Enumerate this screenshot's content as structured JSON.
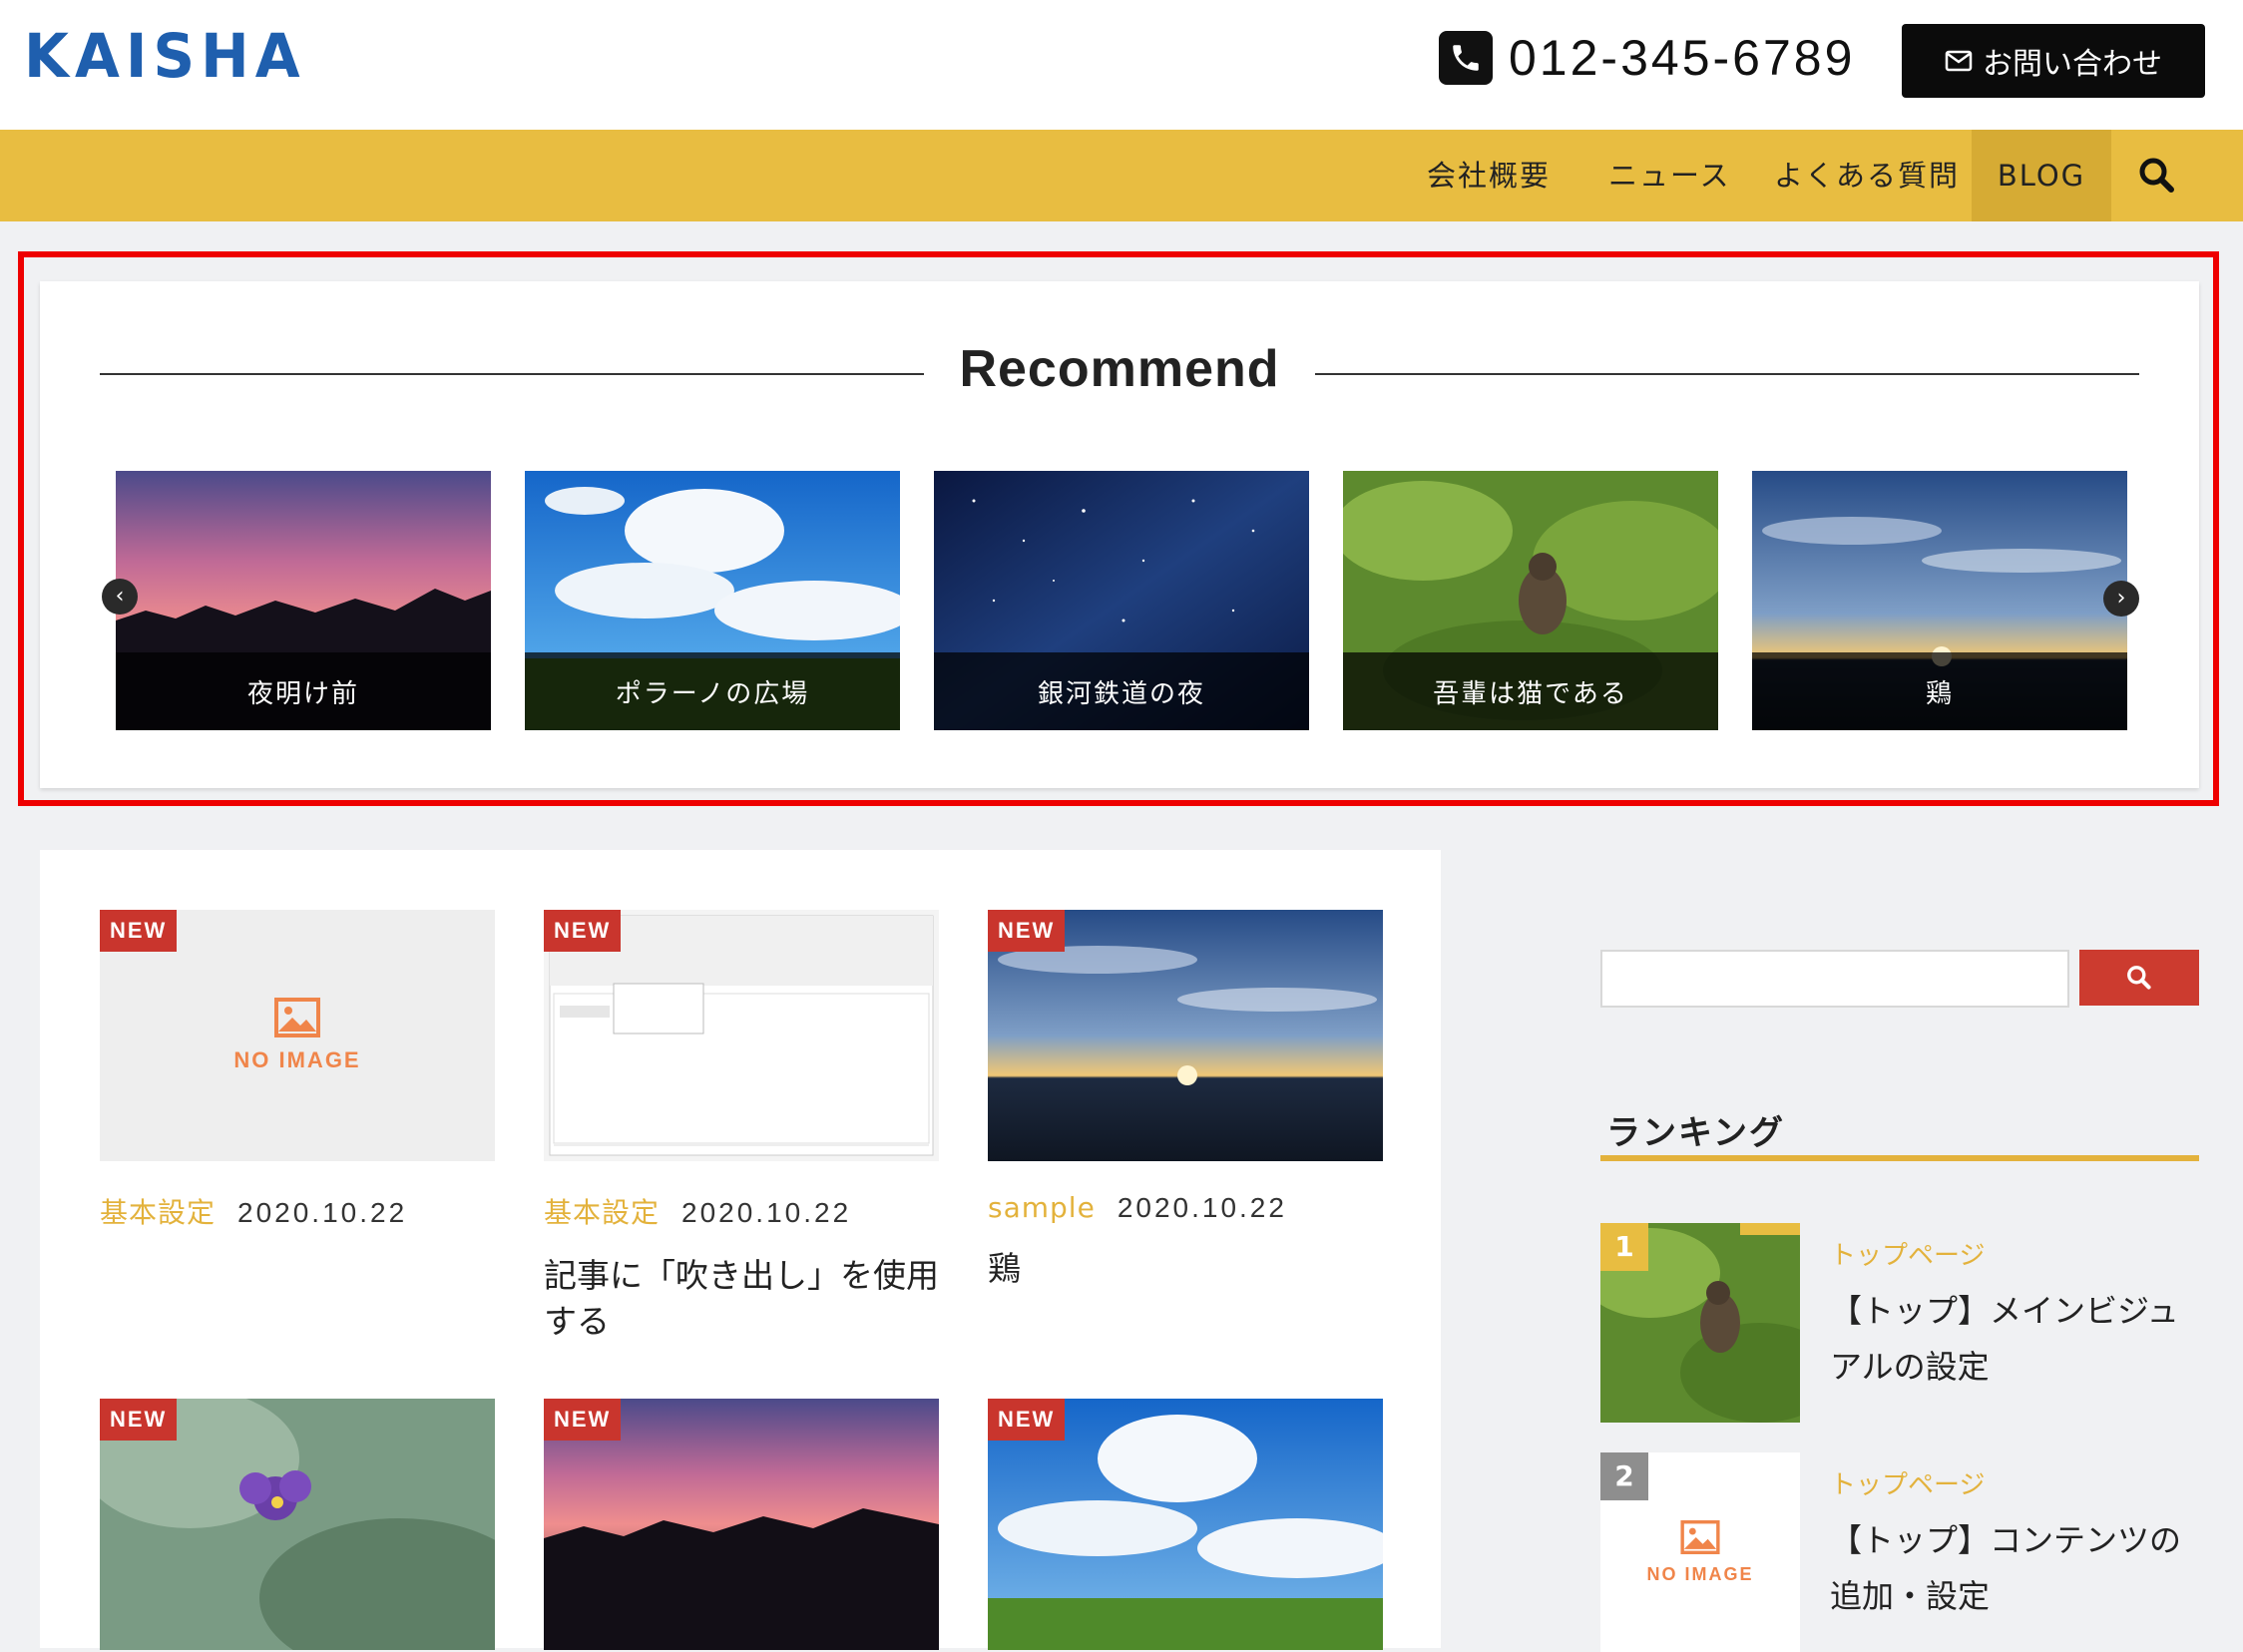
{
  "header": {
    "logo": "KAISHA",
    "phone": "012-345-6789",
    "contact_label": "お問い合わせ"
  },
  "nav": {
    "items": [
      {
        "label": "会社概要"
      },
      {
        "label": "ニュース"
      },
      {
        "label": "よくある質問"
      },
      {
        "label": "BLOG",
        "active": true
      }
    ]
  },
  "recommend": {
    "title": "Recommend",
    "slides": [
      {
        "caption": "夜明け前",
        "image": "pink-sunset-sky"
      },
      {
        "caption": "ポラーノの広場",
        "image": "blue-sky-clouds-field"
      },
      {
        "caption": "銀河鉄道の夜",
        "image": "starry-night-sky"
      },
      {
        "caption": "吾輩は猫である",
        "image": "cat-in-grass"
      },
      {
        "caption": "鶏",
        "image": "sunrise-over-sea"
      }
    ]
  },
  "posts": [
    {
      "badge": "NEW",
      "category": "基本設定",
      "date": "2020.10.22",
      "title": "",
      "image": "no-image",
      "noimage_label": "NO IMAGE"
    },
    {
      "badge": "NEW",
      "category": "基本設定",
      "date": "2020.10.22",
      "title": "記事に「吹き出し」を使用する",
      "image": "editor-screenshot"
    },
    {
      "badge": "NEW",
      "category": "sample",
      "date": "2020.10.22",
      "title": "鶏",
      "image": "sunrise-over-sea"
    },
    {
      "badge": "NEW",
      "image": "purple-pansy"
    },
    {
      "badge": "NEW",
      "image": "pink-sunset-sky"
    },
    {
      "badge": "NEW",
      "image": "blue-sky-clouds-field"
    }
  ],
  "sidebar": {
    "search_placeholder": "",
    "ranking_title": "ランキング",
    "ranking": [
      {
        "rank": "1",
        "category": "トップページ",
        "title": "【トップ】メインビジュアルの設定",
        "image": "cat-in-grass"
      },
      {
        "rank": "2",
        "category": "トップページ",
        "title": "【トップ】コンテンツの追加・設定",
        "image": "no-image",
        "noimage_label": "NO IMAGE"
      }
    ]
  },
  "colors": {
    "nav_bg": "#e8bd41",
    "accent_red": "#c9352d",
    "category_gold": "#e3b23c",
    "logo_blue": "#1f5fae",
    "highlight_border": "#ee0000"
  }
}
